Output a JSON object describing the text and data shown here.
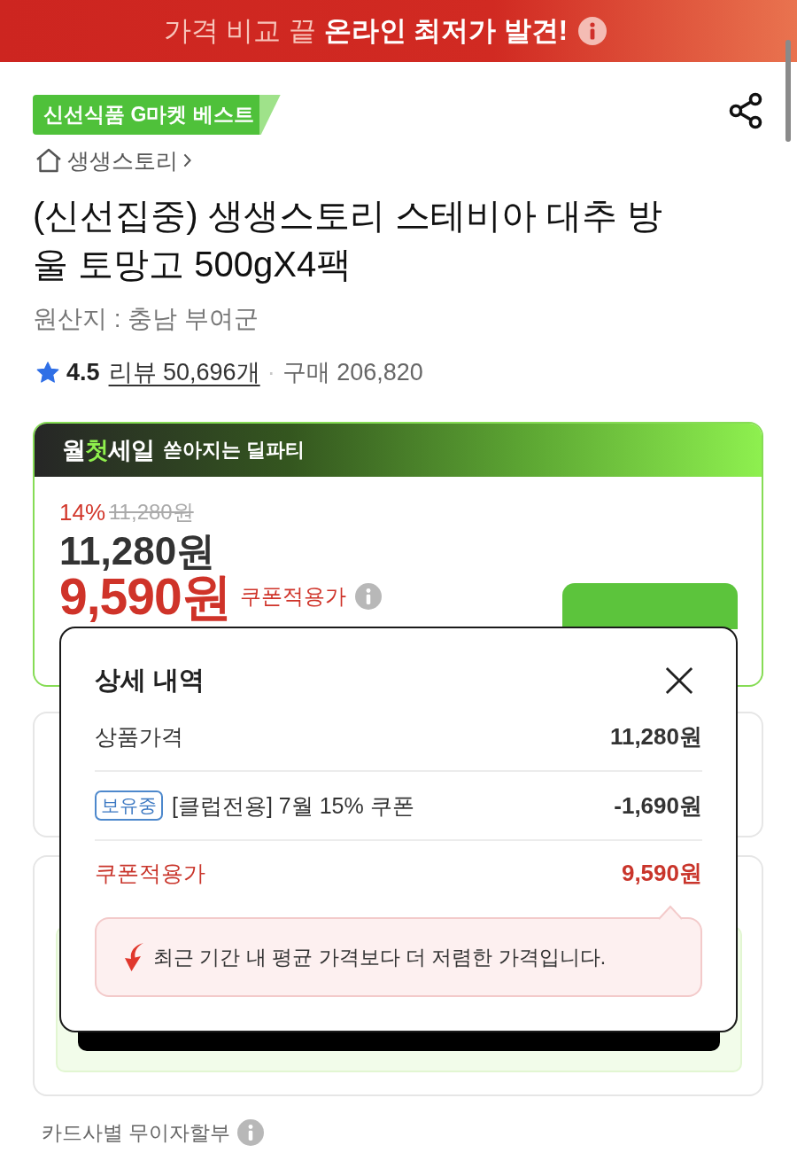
{
  "banner": {
    "text": "가격 비교 끝 **온라인 최저가 발견!**"
  },
  "badge": {
    "label": "신선식품 G마켓 베스트"
  },
  "breadcrumb": {
    "label": "생생스토리"
  },
  "product": {
    "title": "(신선집중) 생생스토리 스테비아 대추 방울 토망고 500gX4팩",
    "origin": "원산지 : 충남 부여군"
  },
  "rating": {
    "score": "4.5",
    "reviews": "리뷰 50,696개",
    "separator": "·",
    "purchases": "구매 206,820"
  },
  "deal": {
    "logo": [
      {
        "text": "월",
        "highlight": false
      },
      {
        "text": "첫",
        "highlight": true
      },
      {
        "text": "세일",
        "highlight": false
      }
    ],
    "tagline": "쏟아지는 딜파티",
    "discount": "14%",
    "original_price": "11,280원",
    "price": "11,280원",
    "coupon_price": "9,590원",
    "coupon_label": "쿠폰적용가"
  },
  "popup": {
    "title": "상세 내역",
    "rows": [
      {
        "kind": "plain",
        "label": "상품가격",
        "amount": "11,280원"
      },
      {
        "kind": "coupon",
        "tag": "보유중",
        "label": "[클럽전용] 7월 15% 쿠폰",
        "amount": "-1,690원"
      },
      {
        "kind": "total",
        "label": "쿠폰적용가",
        "amount": "9,590원"
      }
    ],
    "note": "최근 기간 내 평균 가격보다 더 저렴한 가격입니다."
  },
  "installment": {
    "label": "카드사별 무이자할부"
  }
}
